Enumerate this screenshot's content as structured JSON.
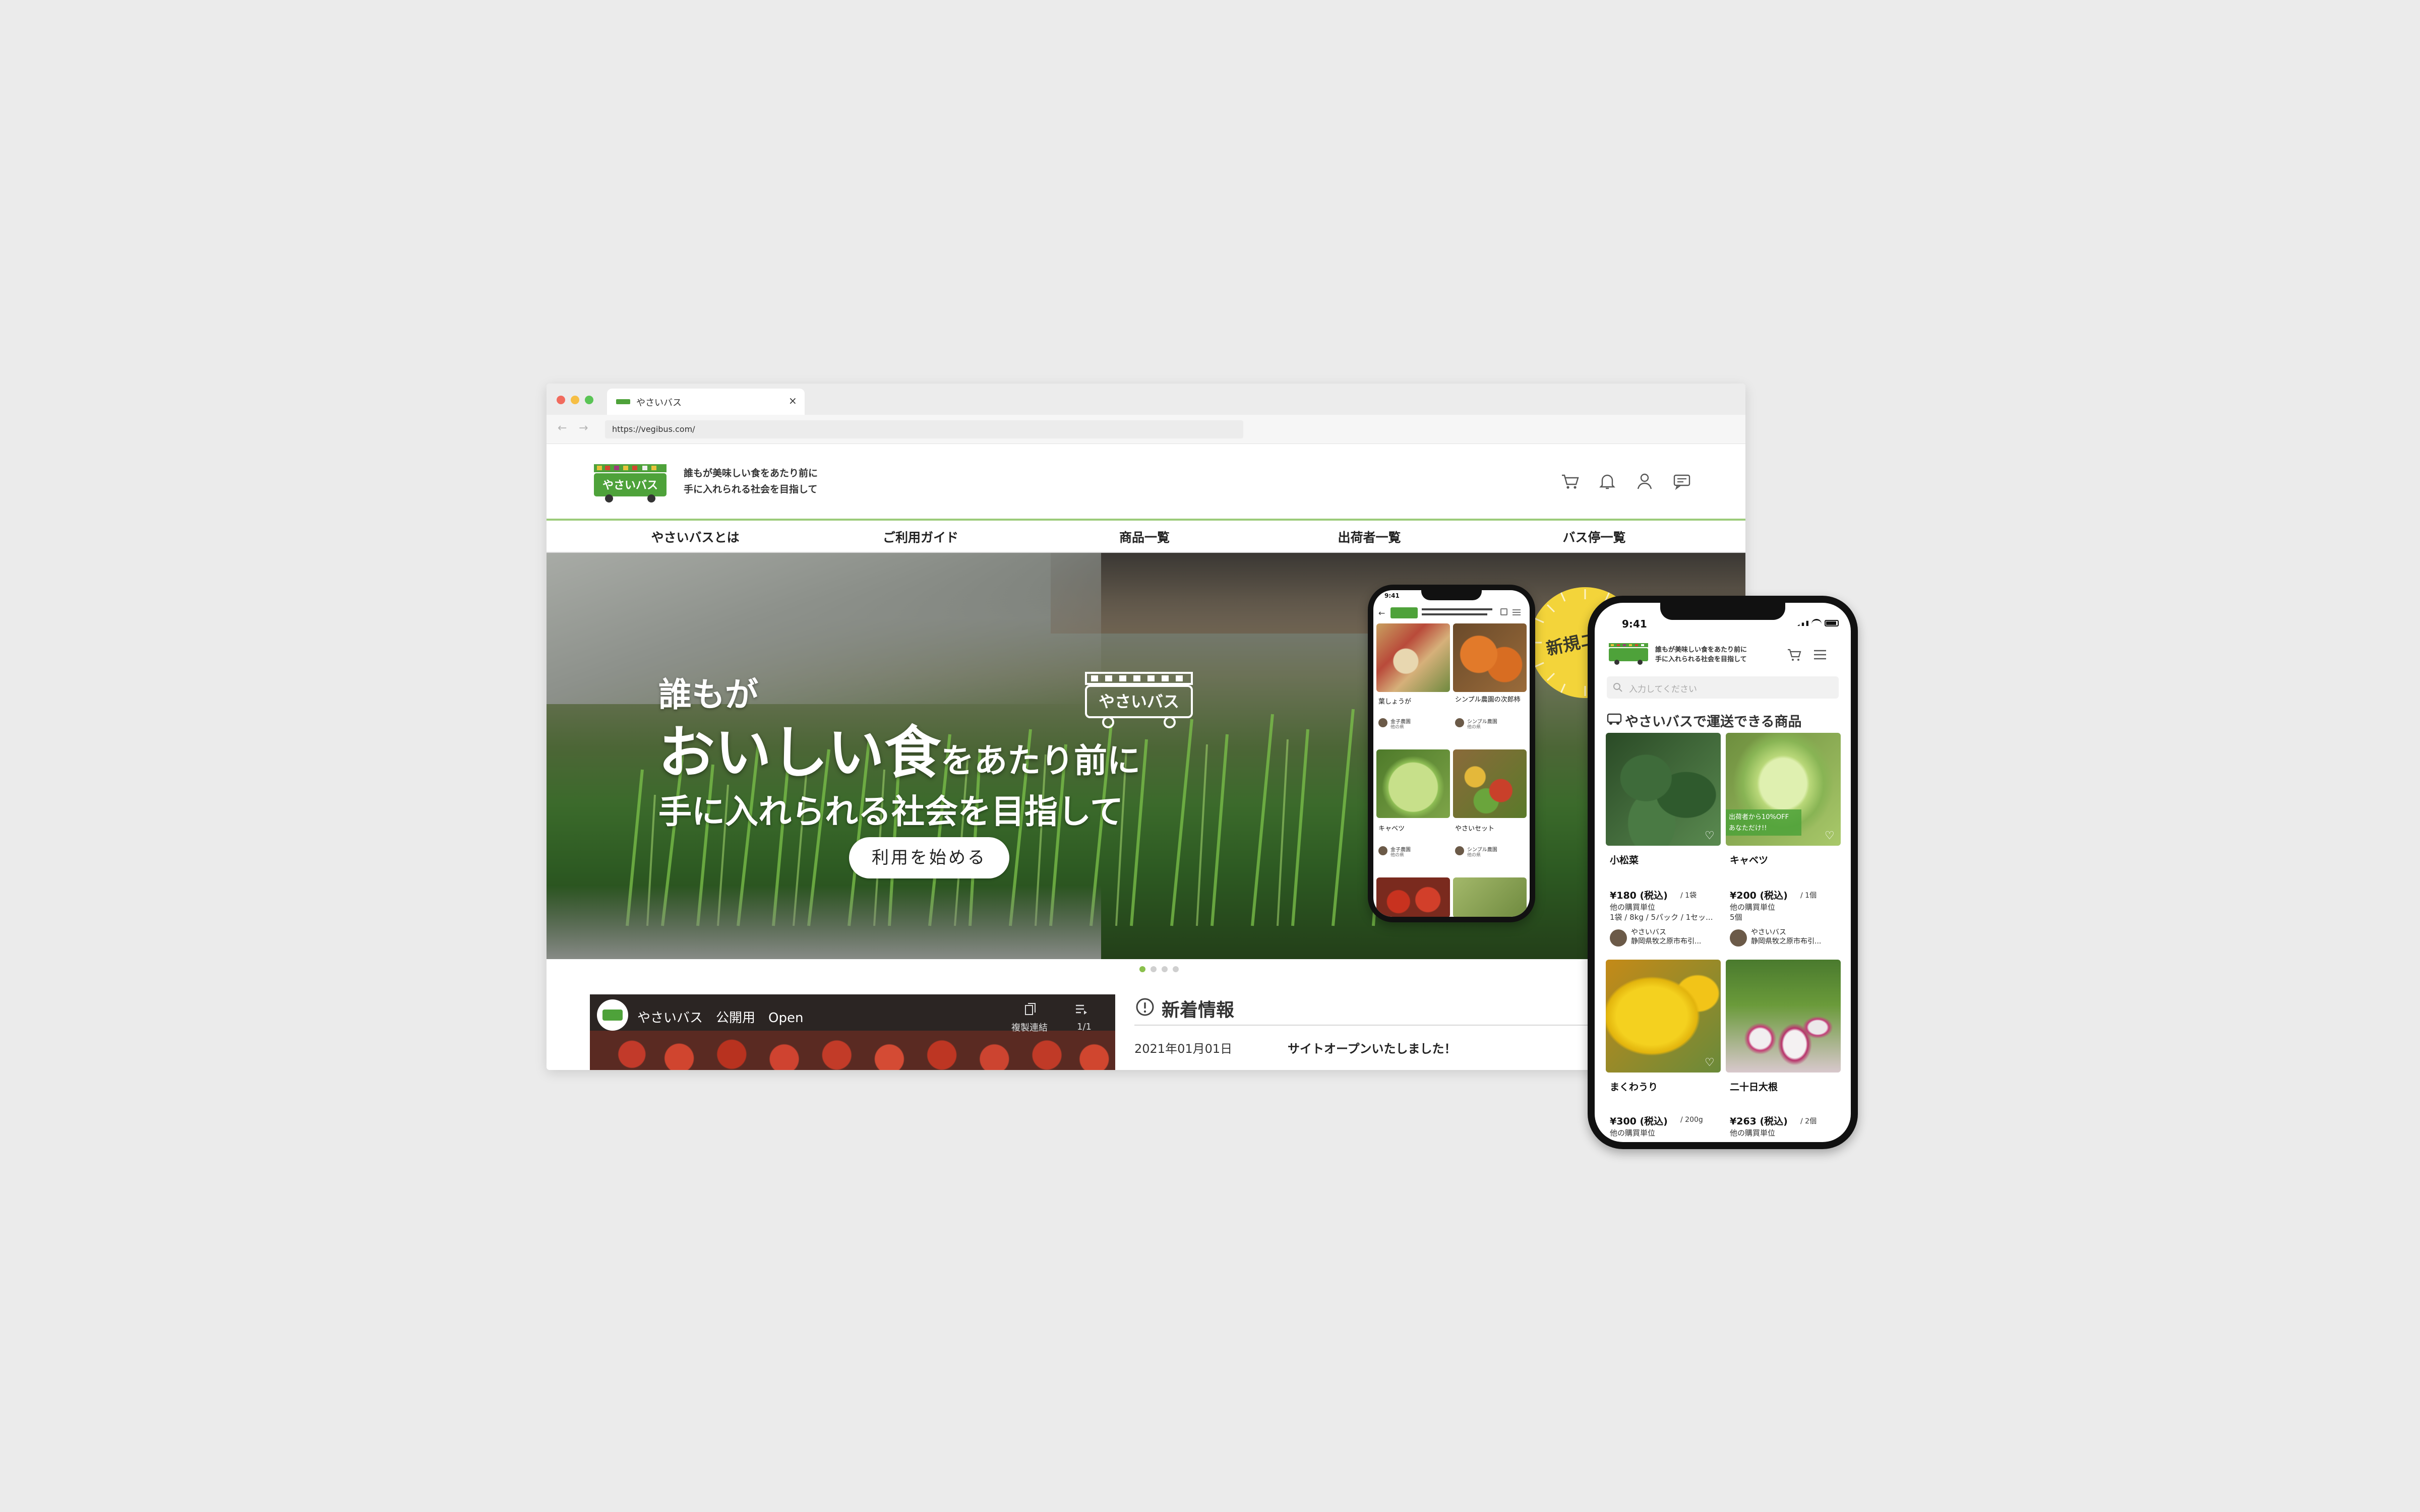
{
  "browser": {
    "tab_title": "やさいバス",
    "tab_close": "×",
    "url": "https://vegibus.com/",
    "back": "←",
    "forward": "→"
  },
  "site": {
    "logo_text": "やさいバス",
    "tagline_line1": "誰もが美味しい食をあたり前に",
    "tagline_line2": "手に入れられる社会を目指して",
    "header_icons": [
      "cart-icon",
      "bell-icon",
      "user-icon",
      "chat-icon"
    ],
    "nav": [
      "やさいバスとは",
      "ご利用ガイド",
      "商品一覧",
      "出荷者一覧",
      "バス停一覧"
    ]
  },
  "hero": {
    "line1": "誰もが",
    "line2_big": "おいしい食",
    "line2_small": "をあたり前に",
    "line3": "手に入れられる社会を目指して",
    "logo_text": "やさいバス",
    "cta": "利用を始める",
    "slides": 4,
    "active_slide": 1
  },
  "badge": {
    "text": "新規ユー 募集中"
  },
  "video": {
    "title": "やさいバス　公開用　Open",
    "copy_label": "複製連結",
    "count": "1/1"
  },
  "news": {
    "heading": "新着情報",
    "date": "2021年01月01日",
    "text": "サイトオープンいたしました！"
  },
  "phone_large": {
    "time": "9:41",
    "tagline_line1": "誰もが美味しい食をあたり前に",
    "tagline_line2": "手に入れられる社会を目指して",
    "search_placeholder": "入力してください",
    "section_title": "やさいバスで運送できる商品",
    "products": [
      {
        "name": "小松菜",
        "price": "¥180 (税込)",
        "unit": "/ 1袋",
        "sub1": "他の購買単位",
        "sub2": "1袋 / 8kg / 5パック / 1セッ...",
        "seller": "やさいバス",
        "seller_loc": "静岡県牧之原市布引..."
      },
      {
        "name": "キャベツ",
        "price": "¥200 (税込)",
        "unit": "/ 1個",
        "sub1": "他の購買単位",
        "sub2": "5個",
        "seller": "やさいバス",
        "seller_loc": "静岡県牧之原市布引...",
        "tag_line1": "出荷者から10%OFF",
        "tag_line2": "あなただけ!!"
      },
      {
        "name": "まくわうり",
        "price": "¥300 (税込)",
        "unit": "/ 200g",
        "sub1": "他の購買単位"
      },
      {
        "name": "二十日大根",
        "price": "¥263 (税込)",
        "unit": "/ 2個",
        "sub1": "他の購買単位"
      }
    ]
  },
  "phone_small": {
    "time": "9:41",
    "products": [
      {
        "name": "葉しょうが"
      },
      {
        "name": "シンプル農園の次郎柿"
      },
      {
        "name": "キャベツ"
      },
      {
        "name": "やさいセット"
      }
    ],
    "sellers": [
      "金子農園",
      "シンプル農園",
      "金子農園",
      "シンプル農園"
    ],
    "seller_subs": [
      "他の県",
      "他の県",
      "他の県",
      "他の県"
    ]
  },
  "colors": {
    "brand_green": "#4ea23a",
    "nav_border": "#9ccb7a",
    "badge_yellow": "#f3d43a",
    "dot_close": "#f16b5e",
    "dot_min": "#f6be44",
    "dot_max": "#5ac455",
    "slider_active": "#8ac04c"
  }
}
